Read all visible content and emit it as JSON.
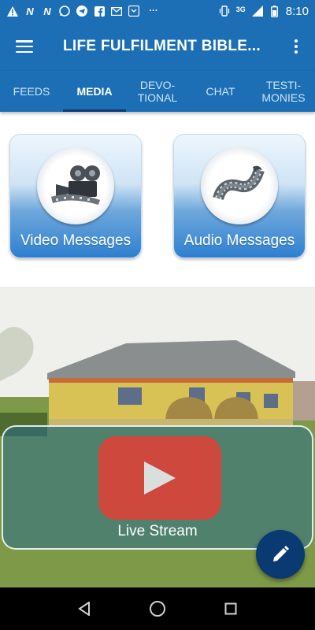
{
  "status_bar": {
    "left_icons": [
      "alert-icon",
      "n-icon",
      "n-icon",
      "whatsapp-icon",
      "telegram-icon",
      "facebook-icon",
      "gmail-icon",
      "download-icon",
      "more-notifications-icon"
    ],
    "network": "3G",
    "time": "8:10"
  },
  "app_bar": {
    "title": "LIFE FULFILMENT BIBLE...",
    "menu_icon": "hamburger-menu-icon",
    "overflow_icon": "more-vert-icon",
    "color": "#1c6fb5"
  },
  "tabs": [
    {
      "label": "FEEDS",
      "active": false
    },
    {
      "label": "MEDIA",
      "active": true
    },
    {
      "label": "DEVO-\nTIONAL",
      "active": false
    },
    {
      "label": "CHAT",
      "active": false
    },
    {
      "label": "TESTI-\nMONIES",
      "active": false
    }
  ],
  "media": {
    "video": {
      "label": "Video Messages",
      "icon": "film-camera-icon"
    },
    "audio": {
      "label": "Audio Messages",
      "icon": "film-reel-icon"
    }
  },
  "live": {
    "label": "Live Stream",
    "icon": "youtube-play-icon"
  },
  "fab": {
    "icon": "edit-pencil-icon"
  },
  "nav": {
    "back": "back-icon",
    "home": "home-icon",
    "recents": "recents-icon"
  },
  "colors": {
    "primary": "#1c6fb5",
    "accent": "#0b3a73",
    "youtube": "#d9443a"
  }
}
